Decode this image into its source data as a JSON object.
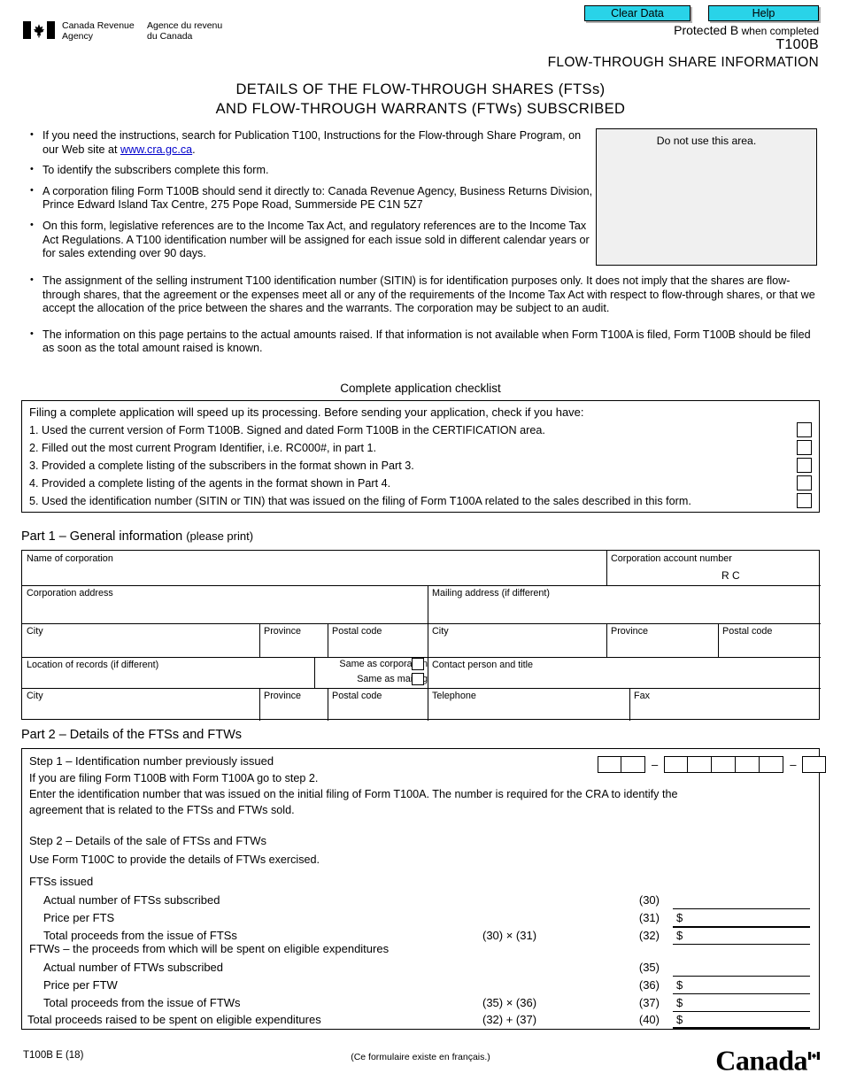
{
  "header": {
    "clear_data_label": "Clear Data",
    "help_label": "Help",
    "protected_strong": "Protected B",
    "protected_rest": " when completed",
    "form_number": "T100B",
    "form_title": "FLOW-THROUGH SHARE INFORMATION",
    "agency_en_line1": "Canada Revenue",
    "agency_en_line2": "Agency",
    "agency_fr_line1": "Agence du revenu",
    "agency_fr_line2": "du Canada"
  },
  "main_title": {
    "line1": "DETAILS OF THE FLOW-THROUGH SHARES (FTSs)",
    "line2": "AND FLOW-THROUGH WARRANTS (FTWs) SUBSCRIBED"
  },
  "do_not_use": "Do not use this area.",
  "bullets": [
    {
      "pre": "If you need the instructions, search for Publication T100, Instructions for the Flow-through Share Program, on our Web site at ",
      "link": "www.cra.gc.ca",
      "post": "."
    },
    {
      "pre": "To identify the subscribers complete this form.",
      "link": "",
      "post": ""
    },
    {
      "pre": "A corporation filing Form T100B should send it directly to: Canada Revenue Agency, Business Returns Division, Prince Edward Island Tax Centre, 275 Pope Road, Summerside PE  C1N 5Z7",
      "link": "",
      "post": ""
    },
    {
      "pre": "On this form, legislative references are to the Income Tax Act, and regulatory references are to the Income Tax Act Regulations. A T100 identification number will be assigned for each issue sold in different calendar years or for sales extending over 90 days.",
      "link": "",
      "post": ""
    }
  ],
  "bullets_wide": [
    "The assignment of the selling instrument T100 identification number (SITIN) is for identification purposes only. It does not imply that the shares are flow-through shares, that the agreement or the expenses meet all or any of the requirements of the Income Tax Act with respect to flow-through shares, or that we accept the allocation of the price between the shares and the warrants. The corporation may be subject to an audit.",
    "The information on this page pertains to the actual amounts raised. If that information is not available when Form T100A is filed, Form T100B should be filed as soon as the total amount raised is known."
  ],
  "checklist": {
    "title": "Complete application checklist",
    "intro": "Filing a complete application will speed up its processing. Before sending your application, check if you have:",
    "items": [
      "1. Used the current version of Form T100B. Signed and dated Form T100B in the CERTIFICATION area.",
      "2. Filled out the most current Program Identifier, i.e. RC000#, in part 1.",
      "3. Provided a complete listing of the subscribers in the format shown in Part 3.",
      "4. Provided a complete listing of the agents in the format shown in Part 4.",
      "5. Used the identification number (SITIN or TIN) that was issued on the filing of Form T100A related to the sales described in this form."
    ]
  },
  "part1": {
    "heading": "Part 1 – General information",
    "heading_sub": "(please print)",
    "name_of_corporation": "Name of corporation",
    "corporation_account_number": "Corporation account number",
    "rc": "R C",
    "corporation_address": "Corporation address",
    "mailing_address": "Mailing address (if different)",
    "city": "City",
    "province": "Province",
    "postal_code": "Postal code",
    "location_of_records": "Location of records  (if different)",
    "same_as_corporation": "Same as corporation",
    "same_as_mailing": "Same as mailing",
    "contact_person": "Contact person and title",
    "telephone": "Telephone",
    "fax": "Fax"
  },
  "part2": {
    "heading": "Part 2 – Details of the FTSs and FTWs",
    "step1_title": "Step 1 – Identification number previously issued",
    "step1_line2": "If you are filing Form T100B with Form T100A go to step 2.",
    "step1_line3": "Enter the identification number that was issued on the initial filing of Form T100A. The number is required for the CRA to identify the",
    "step1_line4": "agreement that is related to the FTSs and FTWs sold.",
    "id_groups": [
      2,
      5,
      1
    ],
    "id_separator": "–",
    "step2_title": "Step 2 – Details of the sale of FTSs and FTWs",
    "step2_line2": "Use Form T100C to provide the details of FTWs exercised.",
    "fts_heading": "FTSs issued",
    "ftw_heading": "FTWs – the proceeds from which will be spent on eligible expenditures",
    "rows": [
      {
        "label": "Actual number of FTSs subscribed",
        "formula": "",
        "code": "(30)",
        "dollar": "",
        "indent": true,
        "thick": false
      },
      {
        "label": "Price per FTS",
        "formula": "",
        "code": "(31)",
        "dollar": "$",
        "indent": true,
        "thick": true
      },
      {
        "label": "Total proceeds from the issue of FTSs",
        "formula": "(30) × (31)",
        "code": "(32)",
        "dollar": "$",
        "indent": true,
        "thick": false
      },
      {
        "label": "Actual number of FTWs subscribed",
        "formula": "",
        "code": "(35)",
        "dollar": "",
        "indent": true,
        "thick": false
      },
      {
        "label": "Price per FTW",
        "formula": "",
        "code": "(36)",
        "dollar": "$",
        "indent": true,
        "thick": false
      },
      {
        "label": "Total proceeds from the issue of FTWs",
        "formula": "(35) × (36)",
        "code": "(37)",
        "dollar": "$",
        "indent": true,
        "thick": false
      },
      {
        "label": "Total proceeds raised to be spent on eligible expenditures",
        "formula": "(32) + (37)",
        "code": "(40)",
        "dollar": "$",
        "indent": false,
        "thick": true
      }
    ]
  },
  "footer": {
    "form_code": "T100B E (18)",
    "french_note": "(Ce formulaire existe en français.)",
    "wordmark": "Canad"
  }
}
